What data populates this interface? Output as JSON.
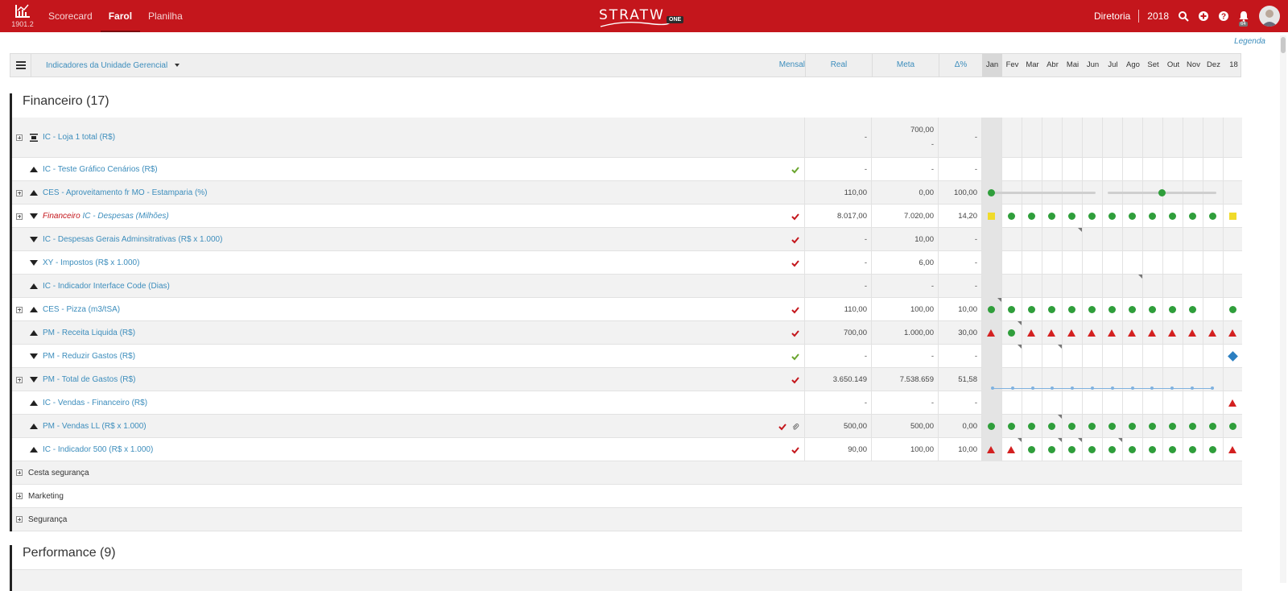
{
  "app": {
    "version": "1901.2",
    "brand": "STRATW",
    "brand_tag": "ONE",
    "nav": [
      {
        "label": "Scorecard",
        "active": false
      },
      {
        "label": "Farol",
        "active": true
      },
      {
        "label": "Planilha",
        "active": false
      }
    ],
    "unit": "Diretoria",
    "year": "2018",
    "notifications": "64",
    "legenda": "Legenda"
  },
  "header": {
    "title": "Indicadores da Unidade Gerencial",
    "periodicity": "Mensal",
    "real": "Real",
    "meta": "Meta",
    "delta": "Δ%",
    "months": [
      "Jan",
      "Fev",
      "Mar",
      "Abr",
      "Mai",
      "Jun",
      "Jul",
      "Ago",
      "Set",
      "Out",
      "Nov",
      "Dez",
      "18"
    ]
  },
  "sections": [
    {
      "title": "Financeiro (17)"
    },
    {
      "title": "Performance (9)"
    }
  ],
  "colors": {
    "topbar": "#c4161c",
    "link": "#3c8dbc",
    "good": "#2f9e3b",
    "bad": "#d32020",
    "warn": "#f0db2a",
    "info": "#2b7fc1"
  },
  "rows": [
    {
      "label": "IC - Loja 1 total (R$)",
      "expand": true,
      "arrow": "bar",
      "check": "",
      "real": "-",
      "meta": "700,00",
      "meta2": "-",
      "delta": "-",
      "marks": []
    },
    {
      "label": "IC - Teste Gráfico Cenários (R$)",
      "expand": false,
      "arrow": "up",
      "check": "green",
      "real": "-",
      "meta": "-",
      "delta": "-",
      "marks": []
    },
    {
      "label": "CES - Aproveitamento fr MO - Estamparia (%)",
      "expand": true,
      "arrow": "up",
      "check": "",
      "real": "110,00",
      "meta": "0,00",
      "delta": "100,00",
      "marks": [],
      "slider": true
    },
    {
      "pre": "Financeiro",
      "label": "IC - Despesas (Milhões)",
      "expand": true,
      "arrow": "down",
      "check": "red",
      "real": "8.017,00",
      "meta": "7.020,00",
      "delta": "14,20",
      "marks": [
        "sq",
        "dot",
        "dot",
        "dot",
        "dot",
        "dot",
        "dot",
        "dot",
        "dot",
        "dot",
        "dot",
        "dot",
        "sq"
      ]
    },
    {
      "label": "IC - Despesas Gerais Adminsitrativas (R$ x 1.000)",
      "expand": false,
      "arrow": "down",
      "check": "red",
      "real": "-",
      "meta": "10,00",
      "delta": "-",
      "marks": [],
      "corners": [
        4
      ]
    },
    {
      "label": "XY - Impostos (R$ x 1.000)",
      "expand": false,
      "arrow": "down",
      "check": "red",
      "real": "-",
      "meta": "6,00",
      "delta": "-",
      "marks": []
    },
    {
      "label": "IC - Indicador Interface Code (Dias)",
      "expand": false,
      "arrow": "up",
      "check": "",
      "real": "-",
      "meta": "-",
      "delta": "-",
      "marks": [],
      "corners": [
        7
      ]
    },
    {
      "label": "CES - Pizza (m3/tSA)",
      "expand": true,
      "arrow": "up",
      "check": "red",
      "real": "110,00",
      "meta": "100,00",
      "delta": "10,00",
      "marks": [
        "dot",
        "dot",
        "dot",
        "dot",
        "dot",
        "dot",
        "dot",
        "dot",
        "dot",
        "dot",
        "dot",
        "",
        "dot"
      ],
      "corners": [
        0
      ]
    },
    {
      "label": "PM - Receita Liquida (R$)",
      "expand": false,
      "arrow": "up",
      "check": "red",
      "real": "700,00",
      "meta": "1.000,00",
      "delta": "30,00",
      "marks": [
        "tri",
        "dot",
        "tri",
        "tri",
        "tri",
        "tri",
        "tri",
        "tri",
        "tri",
        "tri",
        "tri",
        "tri",
        "tri"
      ],
      "corners": [
        1
      ]
    },
    {
      "label": "PM - Reduzir Gastos (R$)",
      "expand": false,
      "arrow": "down",
      "check": "green",
      "real": "-",
      "meta": "-",
      "delta": "-",
      "marks": [
        "",
        "",
        "",
        "",
        "",
        "",
        "",
        "",
        "",
        "",
        "",
        "",
        "dia"
      ],
      "corners": [
        1,
        3
      ]
    },
    {
      "label": "PM - Total de Gastos (R$)",
      "expand": true,
      "arrow": "down",
      "check": "red",
      "real": "3.650.149",
      "meta": "7.538.659",
      "delta": "51,58",
      "marks": [],
      "line": true
    },
    {
      "label": "IC - Vendas - Financeiro (R$)",
      "expand": false,
      "arrow": "up",
      "check": "",
      "real": "-",
      "meta": "-",
      "delta": "-",
      "marks": [
        "",
        "",
        "",
        "",
        "",
        "",
        "",
        "",
        "",
        "",
        "",
        "",
        "tri"
      ]
    },
    {
      "label": "PM - Vendas LL (R$ x 1.000)",
      "expand": false,
      "arrow": "up",
      "check": "red",
      "clip": true,
      "real": "500,00",
      "meta": "500,00",
      "delta": "0,00",
      "marks": [
        "dot",
        "dot",
        "dot",
        "dot",
        "dot",
        "dot",
        "dot",
        "dot",
        "dot",
        "dot",
        "dot",
        "dot",
        "dot"
      ],
      "corners": [
        3
      ]
    },
    {
      "label": "IC - Indicador 500 (R$ x 1.000)",
      "expand": false,
      "arrow": "up",
      "check": "red",
      "real": "90,00",
      "meta": "100,00",
      "delta": "10,00",
      "marks": [
        "tri",
        "tri",
        "dot",
        "dot",
        "dot",
        "dot",
        "dot",
        "dot",
        "dot",
        "dot",
        "dot",
        "dot",
        "tri"
      ],
      "corners": [
        1,
        3,
        4,
        6
      ]
    }
  ],
  "groups": [
    "Cesta segurança",
    "Marketing",
    "Segurança"
  ]
}
